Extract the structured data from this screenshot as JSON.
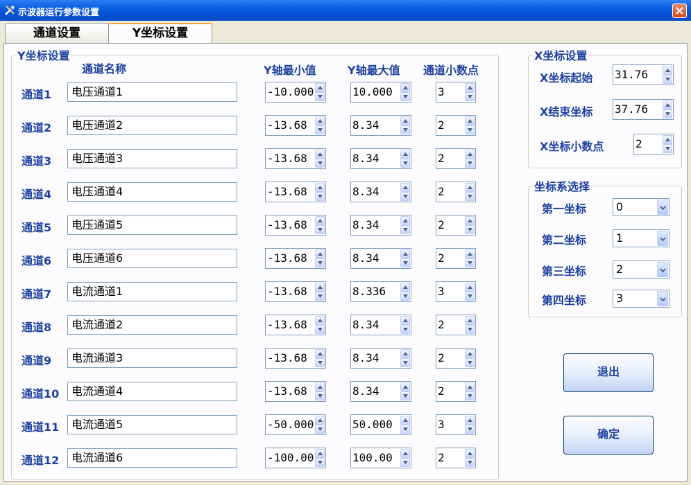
{
  "window": {
    "title": "示波器运行参数设置"
  },
  "tabs": [
    {
      "label": "通道设置",
      "active": false
    },
    {
      "label": "Y坐标设置",
      "active": true
    }
  ],
  "y_group": {
    "legend": "Y坐标设置",
    "headers": {
      "name": "通道名称",
      "ymin": "Y轴最小值",
      "ymax": "Y轴最大值",
      "decimals": "通道小数点"
    },
    "rows": [
      {
        "label": "通道1",
        "name": "电压通道1",
        "ymin": "-10.000",
        "ymax": "10.000",
        "decimals": "3"
      },
      {
        "label": "通道2",
        "name": "电压通道2",
        "ymin": "-13.68",
        "ymax": "8.34",
        "decimals": "2"
      },
      {
        "label": "通道3",
        "name": "电压通道3",
        "ymin": "-13.68",
        "ymax": "8.34",
        "decimals": "2"
      },
      {
        "label": "通道4",
        "name": "电压通道4",
        "ymin": "-13.68",
        "ymax": "8.34",
        "decimals": "2"
      },
      {
        "label": "通道5",
        "name": "电压通道5",
        "ymin": "-13.68",
        "ymax": "8.34",
        "decimals": "2"
      },
      {
        "label": "通道6",
        "name": "电压通道6",
        "ymin": "-13.68",
        "ymax": "8.34",
        "decimals": "2"
      },
      {
        "label": "通道7",
        "name": "电流通道1",
        "ymin": "-13.68",
        "ymax": "8.336",
        "decimals": "3"
      },
      {
        "label": "通道8",
        "name": "电流通道2",
        "ymin": "-13.68",
        "ymax": "8.34",
        "decimals": "2"
      },
      {
        "label": "通道9",
        "name": "电流通道3",
        "ymin": "-13.68",
        "ymax": "8.34",
        "decimals": "2"
      },
      {
        "label": "通道10",
        "name": "电流通道4",
        "ymin": "-13.68",
        "ymax": "8.34",
        "decimals": "2"
      },
      {
        "label": "通道11",
        "name": "电流通道5",
        "ymin": "-50.000",
        "ymax": "50.000",
        "decimals": "3"
      },
      {
        "label": "通道12",
        "name": "电流通道6",
        "ymin": "-100.00",
        "ymax": "100.00",
        "decimals": "2"
      }
    ]
  },
  "x_group": {
    "legend": "X坐标设置",
    "start_label": "X坐标起始",
    "start_value": "31.76",
    "end_label": "X结束坐标",
    "end_value": "37.76",
    "decimals_label": "X坐标小数点",
    "decimals_value": "2"
  },
  "coord_group": {
    "legend": "坐标系选择",
    "items": [
      {
        "label": "第一坐标",
        "value": "0"
      },
      {
        "label": "第二坐标",
        "value": "1"
      },
      {
        "label": "第三坐标",
        "value": "2"
      },
      {
        "label": "第四坐标",
        "value": "3"
      }
    ]
  },
  "buttons": {
    "exit": "退出",
    "ok": "确定"
  }
}
